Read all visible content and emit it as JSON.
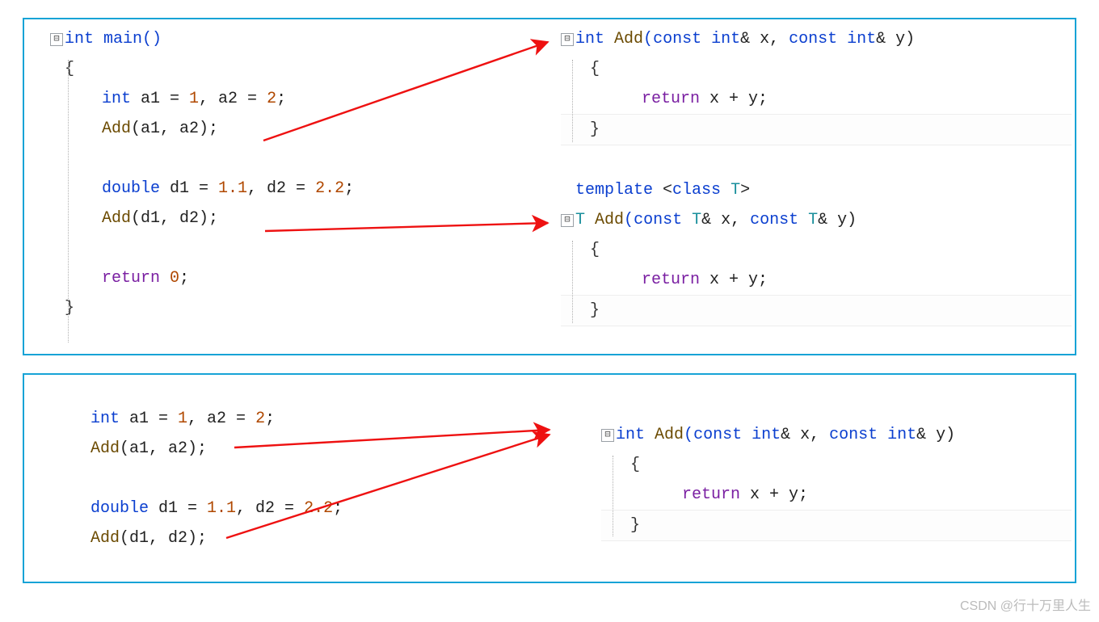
{
  "watermark": "CSDN @行十万里人生",
  "panel1": {
    "left": {
      "fold": "⊟",
      "l0": "int main()",
      "l1": "{",
      "l2_a": "int",
      "l2_b": " a1 = ",
      "l2_c": "1",
      "l2_d": ", a2 = ",
      "l2_e": "2",
      "l2_f": ";",
      "l3_a": "Add",
      "l3_b": "(a1, a2);",
      "l4_a": "double",
      "l4_b": " d1 = ",
      "l4_c": "1.1",
      "l4_d": ", d2 = ",
      "l4_e": "2.2",
      "l4_f": ";",
      "l5_a": "Add",
      "l5_b": "(d1, d2);",
      "l6_a": "return",
      "l6_b": " ",
      "l6_c": "0",
      "l6_d": ";",
      "l7": "}"
    },
    "rightTop": {
      "fold": "⊟",
      "sig_a": "int",
      "sig_b": " ",
      "sig_c": "Add",
      "sig_d": "(",
      "sig_e": "const int",
      "sig_f": "& x, ",
      "sig_g": "const int",
      "sig_h": "& y)",
      "lb": "{",
      "ret_a": "return",
      "ret_b": " x + y;",
      "rb": "}"
    },
    "rightBottom": {
      "tpl_a": "template ",
      "tpl_b": "<",
      "tpl_c": "class",
      "tpl_d": " ",
      "tpl_e": "T",
      "tpl_f": ">",
      "fold": "⊟",
      "sig_a": "T",
      "sig_b": " ",
      "sig_c": "Add",
      "sig_d": "(",
      "sig_e": "const ",
      "sig_f": "T",
      "sig_g": "& x, ",
      "sig_h": "const ",
      "sig_i": "T",
      "sig_j": "& y)",
      "lb": "{",
      "ret_a": "return",
      "ret_b": " x + y;",
      "rb": "}"
    }
  },
  "panel2": {
    "left": {
      "l2_a": "int",
      "l2_b": " a1 = ",
      "l2_c": "1",
      "l2_d": ", a2 = ",
      "l2_e": "2",
      "l2_f": ";",
      "l3_a": "Add",
      "l3_b": "(a1, a2);",
      "l4_a": "double",
      "l4_b": " d1 = ",
      "l4_c": "1.1",
      "l4_d": ", d2 = ",
      "l4_e": "2.2",
      "l4_f": ";",
      "l5_a": "Add",
      "l5_b": "(d1, d2);"
    },
    "right": {
      "fold": "⊟",
      "sig_a": "int",
      "sig_b": " ",
      "sig_c": "Add",
      "sig_d": "(",
      "sig_e": "const int",
      "sig_f": "& x, ",
      "sig_g": "const int",
      "sig_h": "& y)",
      "lb": "{",
      "ret_a": "return",
      "ret_b": " x + y;",
      "rb": "}"
    }
  }
}
